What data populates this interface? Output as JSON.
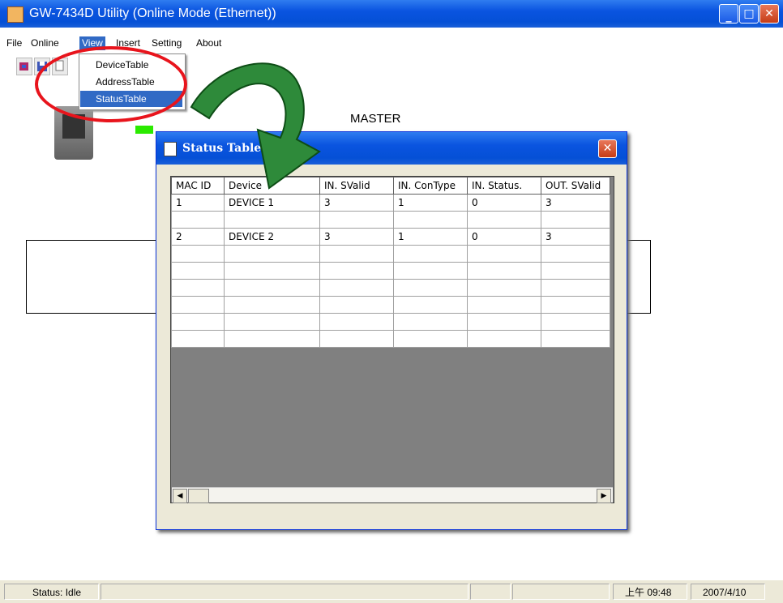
{
  "window": {
    "title": "GW-7434D Utility (Online Mode (Ethernet))"
  },
  "menubar": {
    "file": "File",
    "online": "Online",
    "view": "View",
    "insert": "Insert",
    "setting": "Setting",
    "about": "About"
  },
  "view_menu": {
    "items": [
      "DeviceTable",
      "AddressTable",
      "StatusTable"
    ],
    "selected": "StatusTable"
  },
  "canvas": {
    "master_label": "MASTER"
  },
  "dialog": {
    "title": "Status Table",
    "columns": [
      "MAC ID",
      "Device",
      "IN. SValid",
      "IN. ConType",
      "IN. Status.",
      "OUT. SValid"
    ],
    "rows": [
      [
        "1",
        "DEVICE 1",
        "3",
        "1",
        "0",
        "3"
      ],
      [
        "",
        "",
        "",
        "",
        "",
        ""
      ],
      [
        "2",
        "DEVICE 2",
        "3",
        "1",
        "0",
        "3"
      ],
      [
        "",
        "",
        "",
        "",
        "",
        ""
      ],
      [
        "",
        "",
        "",
        "",
        "",
        ""
      ],
      [
        "",
        "",
        "",
        "",
        "",
        ""
      ],
      [
        "",
        "",
        "",
        "",
        "",
        ""
      ],
      [
        "",
        "",
        "",
        "",
        "",
        ""
      ],
      [
        "",
        "",
        "",
        "",
        "",
        ""
      ]
    ]
  },
  "statusbar": {
    "status": "Status: Idle",
    "time": "上午 09:48",
    "date": "2007/4/10"
  },
  "colors": {
    "xp_blue": "#0a54e0",
    "highlight": "#316ac5",
    "annotation_red": "#e8141c",
    "annotation_green": "#2e8a3a"
  }
}
